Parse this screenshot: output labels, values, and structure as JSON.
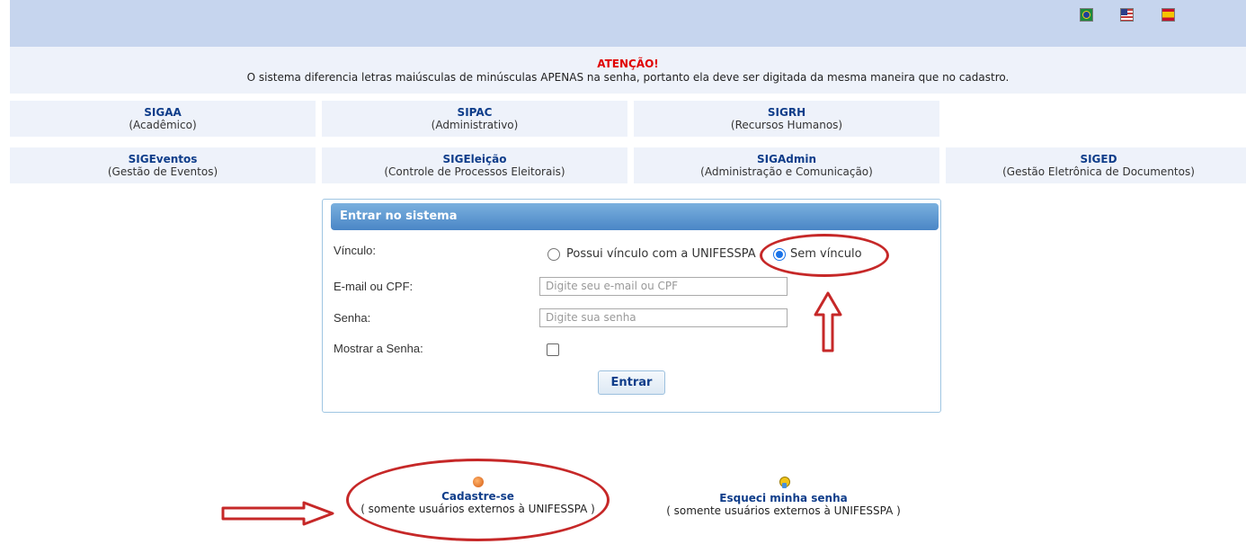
{
  "attention": {
    "title": "ATENÇÃO!",
    "message": "O sistema diferencia letras maiúsculas de minúsculas APENAS na senha, portanto ela deve ser digitada da mesma maneira que no cadastro."
  },
  "systems_row1": [
    {
      "name": "SIGAA",
      "desc": "(Acadêmico)"
    },
    {
      "name": "SIPAC",
      "desc": "(Administrativo)"
    },
    {
      "name": "SIGRH",
      "desc": "(Recursos Humanos)"
    }
  ],
  "systems_row2": [
    {
      "name": "SIGEventos",
      "desc": "(Gestão de Eventos)"
    },
    {
      "name": "SIGEleição",
      "desc": "(Controle de Processos Eleitorais)"
    },
    {
      "name": "SIGAdmin",
      "desc": "(Administração e Comunicação)"
    },
    {
      "name": "SIGED",
      "desc": "(Gestão Eletrônica de Documentos)"
    }
  ],
  "login": {
    "header": "Entrar no sistema",
    "vinculo_label": "Vínculo:",
    "radio_with": "Possui vínculo com a UNIFESSPA",
    "radio_without": "Sem vínculo",
    "email_label": "E-mail ou CPF:",
    "email_placeholder": "Digite seu e-mail ou CPF",
    "senha_label": "Senha:",
    "senha_placeholder": "Digite sua senha",
    "show_label": "Mostrar a Senha:",
    "submit": "Entrar"
  },
  "links": {
    "cadastro_title": "Cadastre-se",
    "cadastro_note": "( somente usuários externos à UNIFESSPA )",
    "esqueci_title": "Esqueci minha senha",
    "esqueci_note": "( somente usuários externos à UNIFESSPA )"
  },
  "icons": {
    "flags": [
      "brazil-flag-icon",
      "usa-flag-icon",
      "spain-flag-icon"
    ],
    "cadastro": "person-icon",
    "esqueci": "key-icon"
  },
  "colors": {
    "annotation": "#c62828",
    "system_name": "#0f3d8a",
    "attention": "#e00000"
  }
}
